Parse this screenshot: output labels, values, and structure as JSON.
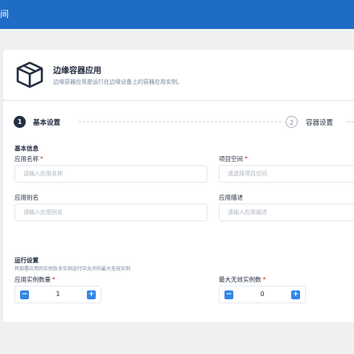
{
  "topbar": {
    "title": "间"
  },
  "hero": {
    "icon": "box-icon",
    "title": "边缘容器应用",
    "description": "边缘容器应用是运行在边缘设备上的容器应用实例。"
  },
  "steps": [
    {
      "number": "1",
      "label": "基本设置",
      "state": "active"
    },
    {
      "number": "2",
      "label": "容器设置",
      "state": "pending"
    }
  ],
  "basic_info": {
    "section_title": "基本信息",
    "app_name": {
      "label": "应用名称",
      "required": "*",
      "placeholder": "请输入应用名称"
    },
    "project_space": {
      "label": "项目空间",
      "required": "*",
      "placeholder": "请选择项目空间"
    },
    "app_alias": {
      "label": "应用别名",
      "placeholder": "请输入应用别名"
    },
    "app_desc": {
      "label": "应用描述",
      "placeholder": "请输入应用描述"
    }
  },
  "run_settings": {
    "section_title": "运行设置",
    "description": "将部署应用的实例及多实例运行中允许的最大无效实例",
    "instance_count": {
      "label": "应用实例数量",
      "required": "*",
      "value": "1",
      "minus": "−",
      "plus": "+"
    },
    "max_invalid": {
      "label": "最大无效实例数",
      "required": "*",
      "value": "0",
      "minus": "−",
      "plus": "+"
    }
  },
  "colors": {
    "primary": "#1f6cc6",
    "accent": "#3385e5",
    "required": "#ca2621",
    "text": "#242e42",
    "muted": "#79879c"
  }
}
